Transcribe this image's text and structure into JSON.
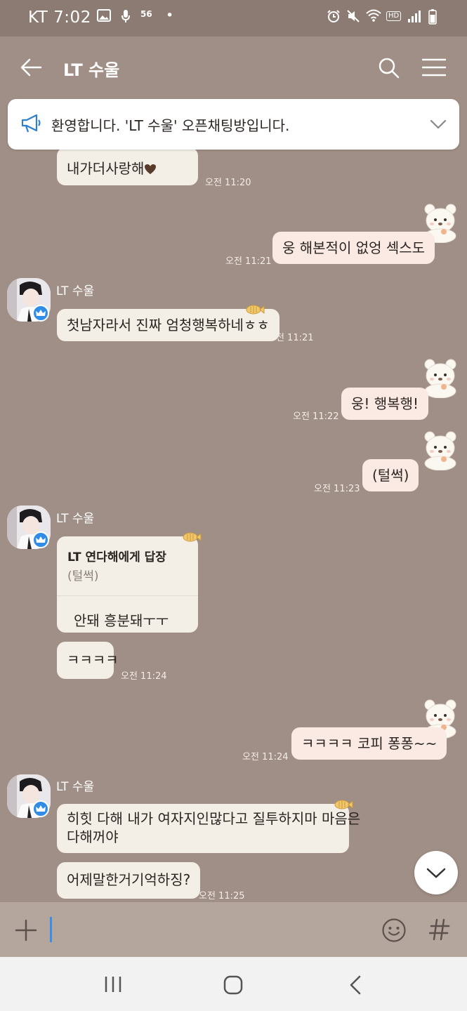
{
  "status_bar": {
    "carrier": "KT",
    "time": "7:02",
    "network_label": "56",
    "hd_label": "HD"
  },
  "header": {
    "title": "LT 수울",
    "icons": [
      "back-arrow-icon",
      "search-icon",
      "menu-icon"
    ]
  },
  "notice": {
    "text": "환영합니다. 'LT 수울' 오픈채팅방입니다."
  },
  "messages": [
    {
      "dir": "in",
      "text": "내가더사랑해",
      "emoji": "brown-heart",
      "time": "오전 11:20"
    },
    {
      "dir": "out",
      "text": "웅 해본적이 없엉 섹스도",
      "time": "오전 11:21"
    },
    {
      "dir": "in",
      "sender": "LT 수울",
      "text": "첫남자라서 진짜 엄청행복하네ㅎㅎ",
      "time": "오전 11:21"
    },
    {
      "dir": "out",
      "text": "웅! 행복행!",
      "time": "오전 11:22"
    },
    {
      "dir": "out",
      "text": "(털썩)",
      "time": "오전 11:23"
    },
    {
      "dir": "in",
      "sender": "LT 수울",
      "reply": {
        "title": "LT 연다해에게 답장",
        "quote": "(털썩)",
        "text": "안돼 흥분돼ㅜㅜ"
      }
    },
    {
      "dir": "in",
      "text": "ㅋㅋㅋㅋ",
      "time": "오전 11:24"
    },
    {
      "dir": "out",
      "text": "ㅋㅋㅋㅋ 코피 퐁퐁~~",
      "time": "오전 11:24"
    },
    {
      "dir": "in",
      "sender": "LT 수울",
      "text_line1": "히힛 다해 내가 여자지인많다고 질투하지마 마음은",
      "text_line2": "다해꺼야"
    },
    {
      "dir": "in",
      "text": "어제말한거기억하징?",
      "time": "오전 11:25"
    }
  ],
  "input": {
    "value": "",
    "icons": [
      "plus-icon",
      "emoji-icon",
      "hashtag-icon"
    ]
  },
  "nav": {
    "icons": [
      "recents-icon",
      "home-icon",
      "back-icon"
    ]
  },
  "colors": {
    "background": "#a08f86",
    "incoming_bubble": "#f3eee6",
    "outgoing_bubble": "#fbe9e4",
    "input_bar": "#b5a69d",
    "accent": "#3b8fe6"
  }
}
